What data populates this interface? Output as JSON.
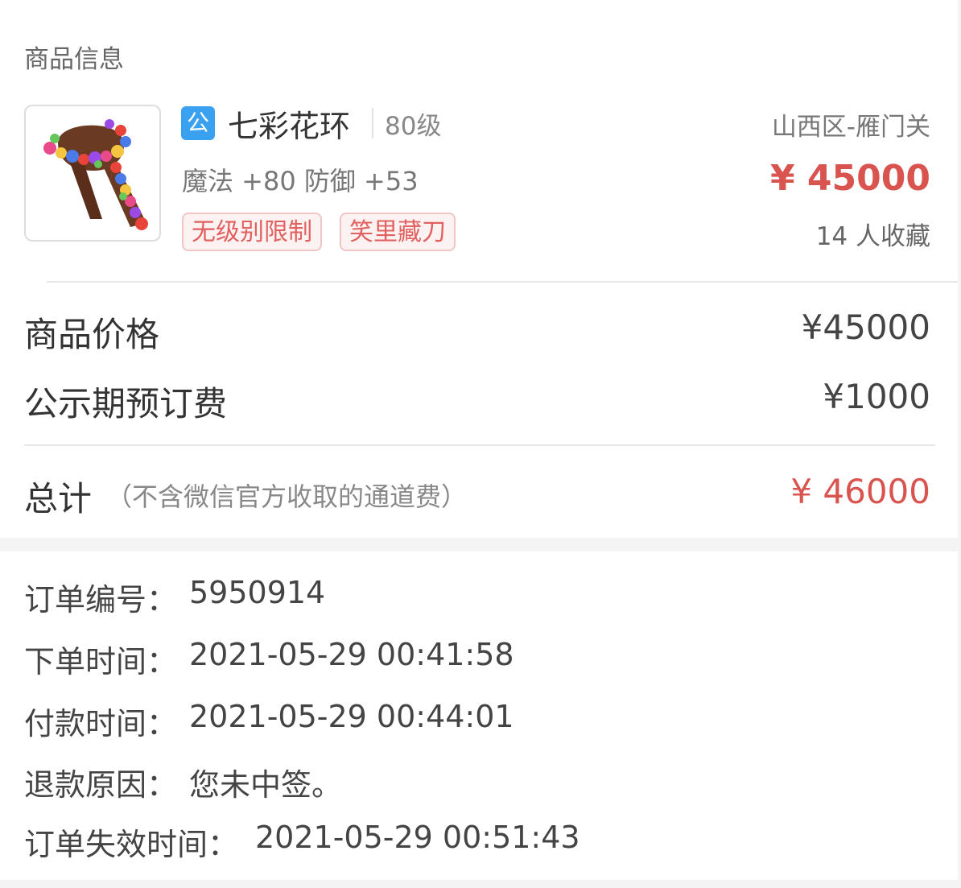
{
  "section": {
    "title": "商品信息"
  },
  "item": {
    "badge": "公",
    "name": "七彩花环",
    "level": "80级",
    "stats": "魔法 +80 防御 +53",
    "tags": [
      "无级别限制",
      "笑里藏刀"
    ],
    "server": "山西区-雁门关",
    "price": "¥ 45000",
    "favorites": "14 人收藏",
    "image_icon": "flower-garland-icon"
  },
  "pricing": {
    "rows": [
      {
        "label": "商品价格",
        "value": "¥45000"
      },
      {
        "label": "公示期预订费",
        "value": "¥1000"
      }
    ],
    "total_label": "总计",
    "total_note": "（不含微信官方收取的通道费）",
    "total_value": "¥ 46000"
  },
  "order": {
    "rows": [
      {
        "label": "订单编号：",
        "value": "5950914"
      },
      {
        "label": "下单时间：",
        "value": "2021-05-29 00:41:58"
      },
      {
        "label": "付款时间：",
        "value": "2021-05-29 00:44:01"
      },
      {
        "label": "退款原因：",
        "value": "您未中签。"
      },
      {
        "label": "订单失效时间：",
        "value": "2021-05-29 00:51:43"
      }
    ]
  },
  "colors": {
    "price_red": "#d9534f",
    "tag_red": "#e0615f",
    "badge_blue": "#3aa0f0"
  }
}
